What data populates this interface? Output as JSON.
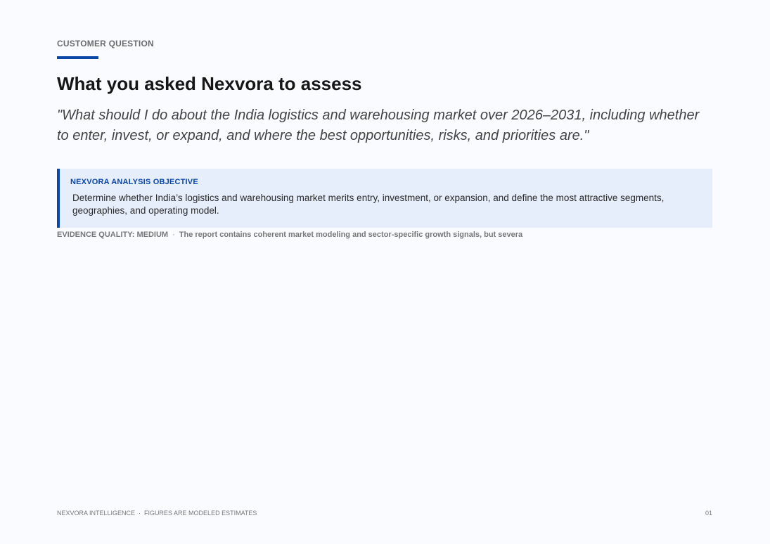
{
  "header": {
    "eyebrow": "CUSTOMER QUESTION",
    "title": "What you asked Nexvora to assess"
  },
  "question": {
    "quote": "\"What should I do about the India logistics and warehousing market over 2026–2031, including whether to enter, invest, or expand, and where the best opportunities, risks, and priorities are.\""
  },
  "objective": {
    "label": "NEXVORA ANALYSIS OBJECTIVE",
    "text": "Determine whether India’s logistics and warehousing market merits entry, investment, or expansion, and define the most attractive segments, geographies, and operating model."
  },
  "evidence": {
    "quality_label": "EVIDENCE QUALITY: MEDIUM",
    "separator": "·",
    "note": "The report contains coherent market modeling and sector-specific growth signals, but severa"
  },
  "footer": {
    "brand": "NEXVORA INTELLIGENCE",
    "separator": "·",
    "disclaimer": "FIGURES ARE MODELED ESTIMATES",
    "page_number": "01"
  },
  "colors": {
    "accent": "#0a47a9",
    "objective_background": "#e6edfb",
    "page_background": "#fafbfe"
  }
}
